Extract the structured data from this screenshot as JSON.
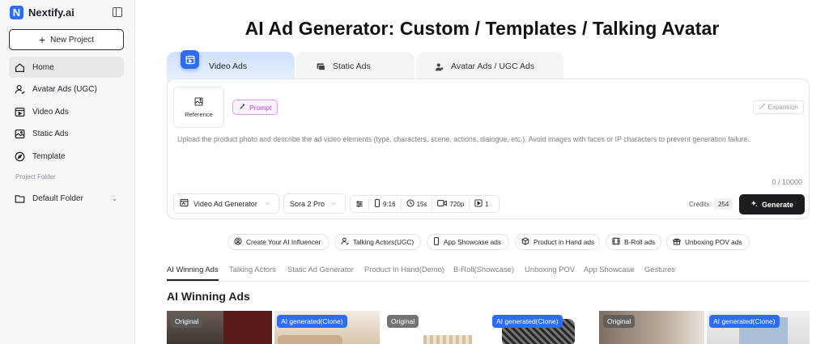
{
  "app": {
    "name": "Nextify.ai",
    "logo_letter": "N"
  },
  "sidebar": {
    "new_project_label": "New Project",
    "items": [
      {
        "label": "Home",
        "icon": "home-icon",
        "active": true
      },
      {
        "label": "Avatar Ads (UGC)",
        "icon": "person-icon"
      },
      {
        "label": "Video Ads",
        "icon": "video-icon"
      },
      {
        "label": "Static Ads",
        "icon": "image-icon"
      },
      {
        "label": "Template",
        "icon": "compass-icon"
      }
    ],
    "folder_caption": "Project Folder",
    "folder_item": "Default Folder"
  },
  "page": {
    "title": "AI Ad Generator: Custom / Templates / Talking Avatar"
  },
  "mode_tabs": [
    {
      "label": "Video Ads",
      "icon": "video-ads-icon",
      "active": true
    },
    {
      "label": "Static Ads",
      "icon": "image-icon"
    },
    {
      "label": "Avatar Ads / UGC Ads",
      "icon": "avatar-icon"
    }
  ],
  "composer": {
    "reference_label": "Reference",
    "prompt_label": "Prompt",
    "expansion_label": "Expansion",
    "placeholder": "Upload the product photo and describe the ad video elements (type, characters, scene, actions, dialogue, etc.). Avoid images with faces or IP characters to prevent generation failure.",
    "char_count": "0 / 10000",
    "generator_select": "Video Ad Generator",
    "model_select": "Sora 2 Pro",
    "options": {
      "ratio": "9:16",
      "duration": "15s",
      "resolution": "720p",
      "count": "1"
    },
    "credits_label": "Credits",
    "credits_value": "254",
    "generate_label": "Generate"
  },
  "quick_actions": [
    {
      "label": "Create Your AI Influencer",
      "icon": "person-circle-icon"
    },
    {
      "label": "Talking Actors(UGC)",
      "icon": "person-icon"
    },
    {
      "label": "App Showcase ads",
      "icon": "phone-icon"
    },
    {
      "label": "Product in Hand ads",
      "icon": "box-icon"
    },
    {
      "label": "B-Roll ads",
      "icon": "film-icon"
    },
    {
      "label": "Unboxing POV ads",
      "icon": "gift-icon"
    }
  ],
  "category_tabs": [
    "AI Winning Ads",
    "Talking Actors",
    "Static Ad Generator",
    "Product In Hand(Demo)",
    "B-Roll(Showcase)",
    "Unboxing POV",
    "App Showcase",
    "Gestures"
  ],
  "section_title": "AI Winning Ads",
  "gallery": {
    "original_label": "Original",
    "ai_label": "AI generated(Clone)"
  },
  "colors": {
    "accent": "#2d6df6",
    "prompt_chip": "#b444cf",
    "generate_bg": "#1c1d20"
  }
}
